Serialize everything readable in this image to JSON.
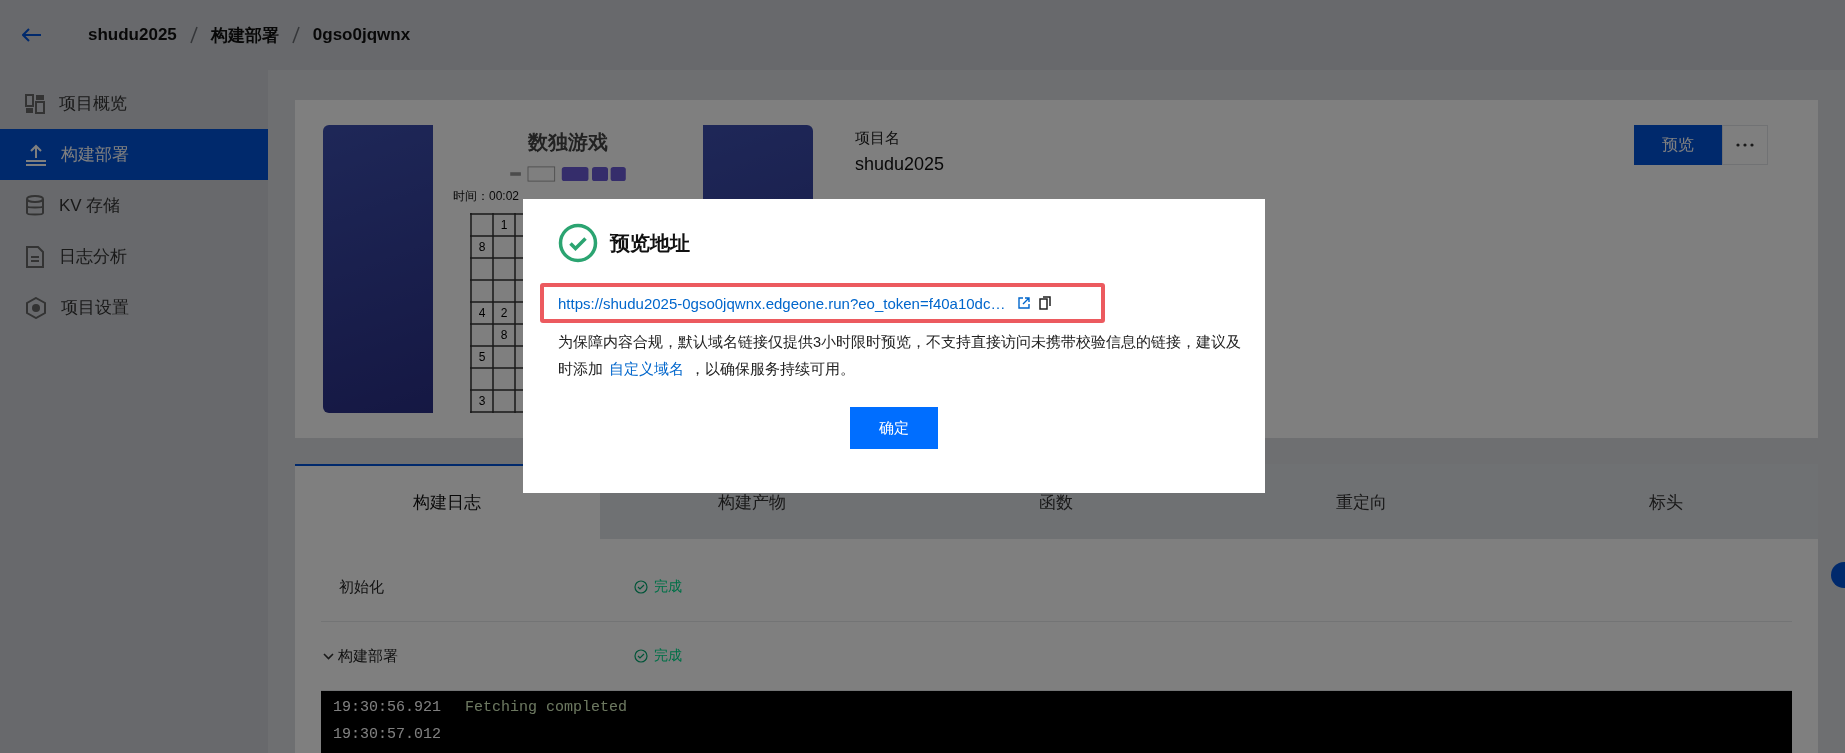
{
  "header": {
    "breadcrumb": [
      "shudu2025",
      "构建部署",
      "0gso0jqwnx"
    ]
  },
  "sidebar": {
    "items": [
      {
        "label": "项目概览",
        "selected": false
      },
      {
        "label": "构建部署",
        "selected": true
      },
      {
        "label": "KV 存储",
        "selected": false
      },
      {
        "label": "日志分析",
        "selected": false
      },
      {
        "label": "项目设置",
        "selected": false
      }
    ]
  },
  "project": {
    "thumbnail": {
      "title": "数独游戏",
      "timer": "时间：00:02",
      "grid_digits": [
        "1",
        "8",
        "4",
        "2",
        "8",
        "5",
        "3"
      ]
    },
    "name_label": "项目名",
    "name": "shudu2025",
    "preview_button": "预览"
  },
  "tabs": [
    {
      "label": "构建日志",
      "selected": true
    },
    {
      "label": "构建产物",
      "selected": false
    },
    {
      "label": "函数",
      "selected": false
    },
    {
      "label": "重定向",
      "selected": false
    },
    {
      "label": "标头",
      "selected": false
    }
  ],
  "steps": [
    {
      "kind": "plain",
      "name": "初始化",
      "status": "完成"
    },
    {
      "kind": "collapsible",
      "name": "构建部署",
      "status": "完成",
      "expanded": true
    }
  ],
  "console": [
    {
      "time": "19:30:56.921",
      "message": "Fetching completed"
    },
    {
      "time": "19:30:57.012"
    }
  ],
  "modal": {
    "title": "预览地址",
    "url": "https://shudu2025-0gso0jqwnx.edgeone.run?eo_token=f40a10dc…",
    "url_highlighted": true,
    "notice_before": "为保障内容合规，默认域名链接仅提供3小时限时预览，不支持直接访问未携带校验信息的链接，建议及时添加",
    "notice_link": "自定义域名",
    "notice_after": "，以确保服务持续可用。",
    "confirm": "确定"
  }
}
